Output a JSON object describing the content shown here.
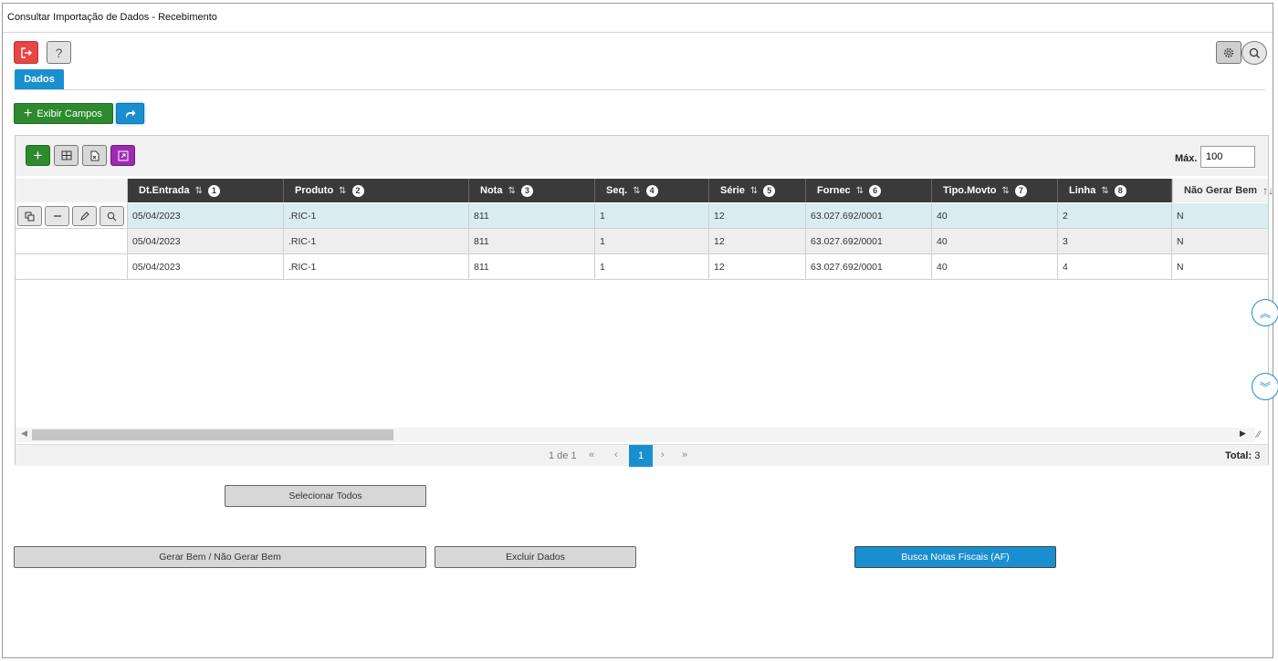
{
  "window": {
    "title": "Consultar Importação de Dados - Recebimento"
  },
  "toolbar": {
    "help_label": "?"
  },
  "tabs": [
    {
      "label": "Dados"
    }
  ],
  "actions": {
    "exibir_campos": "Exibir Campos"
  },
  "grid": {
    "max_label": "Máx.",
    "max_value": "100",
    "columns": [
      {
        "label": "Dt.Entrada",
        "order": "1"
      },
      {
        "label": "Produto",
        "order": "2"
      },
      {
        "label": "Nota",
        "order": "3"
      },
      {
        "label": "Seq.",
        "order": "4"
      },
      {
        "label": "Série",
        "order": "5"
      },
      {
        "label": "Fornec",
        "order": "6"
      },
      {
        "label": "Tipo.Movto",
        "order": "7"
      },
      {
        "label": "Linha",
        "order": "8"
      },
      {
        "label": "Não Gerar Bem",
        "order": ""
      }
    ],
    "rows": [
      [
        "05/04/2023",
        ".RIC-1",
        "811",
        "1",
        "12",
        "63.027.692/0001",
        "40",
        "2",
        "N"
      ],
      [
        "05/04/2023",
        ".RIC-1",
        "811",
        "1",
        "12",
        "63.027.692/0001",
        "40",
        "3",
        "N"
      ],
      [
        "05/04/2023",
        ".RIC-1",
        "811",
        "1",
        "12",
        "63.027.692/0001",
        "40",
        "4",
        "N"
      ]
    ],
    "pager": {
      "info": "1 de 1",
      "first": "«",
      "prev": "‹",
      "current": "1",
      "next": "›",
      "last": "»"
    },
    "total_label": "Total:",
    "total_value": "3"
  },
  "buttons": {
    "selecionar_todos": "Selecionar Todos",
    "gerar_bem": "Gerar Bem / Não Gerar Bem",
    "excluir_dados": "Excluir Dados",
    "busca_notas": "Busca Notas Fiscais (AF)"
  },
  "colors": {
    "accent": "#1a8fd0",
    "green": "#2d8a2d",
    "red": "#e84545",
    "purple": "#9c2bb0",
    "header_dark": "#3a3a3a",
    "selected_row": "#d8ecf1"
  }
}
